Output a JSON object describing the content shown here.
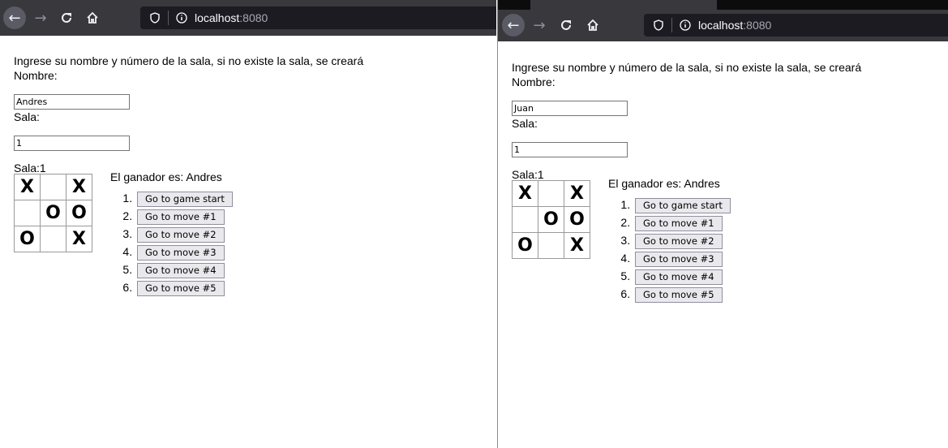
{
  "browser": {
    "url_host": "localhost",
    "url_port": ":8080"
  },
  "page": {
    "intro": "Ingrese su nombre y número de la sala, si no existe la sala, se creará",
    "name_label": "Nombre:",
    "room_label": "Sala:",
    "room_heading": "Sala:1",
    "winner_text": "El ganador es: Andres",
    "moves": [
      "Go to game start",
      "Go to move #1",
      "Go to move #2",
      "Go to move #3",
      "Go to move #4",
      "Go to move #5"
    ],
    "board": [
      "X",
      "",
      "X",
      "",
      "O",
      "O",
      "O",
      "",
      "X"
    ]
  },
  "windows": {
    "left": {
      "name_value": "Andres",
      "room_value": "1"
    },
    "right": {
      "name_value": "Juan",
      "room_value": "1"
    }
  },
  "colors": {
    "toolbar": "#38383d",
    "urlbar": "#1c1b22",
    "button": "#e9e9ed"
  }
}
